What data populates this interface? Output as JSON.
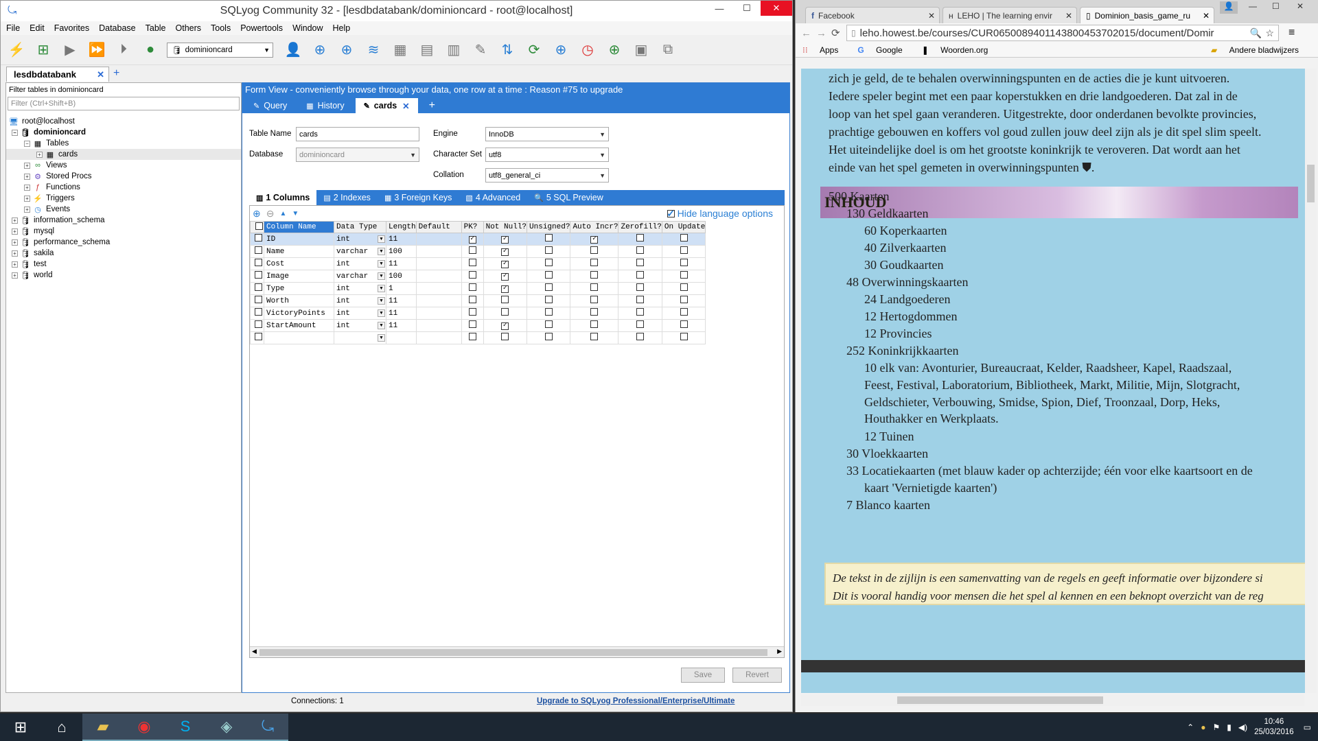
{
  "sqlyog": {
    "title": "SQLyog Community 32 - [lesdbdatabank/dominioncard - root@localhost]",
    "menu": [
      "File",
      "Edit",
      "Favorites",
      "Database",
      "Table",
      "Others",
      "Tools",
      "Powertools",
      "Window",
      "Help"
    ],
    "db_selector": "dominioncard",
    "connection_tab": "lesdbdatabank",
    "filter_label": "Filter tables in dominioncard",
    "filter_placeholder": "Filter (Ctrl+Shift+B)",
    "tree": {
      "root": "root@localhost",
      "db": "dominioncard",
      "tables": "Tables",
      "table": "cards",
      "views": "Views",
      "procs": "Stored Procs",
      "functions": "Functions",
      "triggers": "Triggers",
      "events": "Events",
      "other_dbs": [
        "information_schema",
        "mysql",
        "performance_schema",
        "sakila",
        "test",
        "world"
      ]
    },
    "banner": "Form View - conveniently browse through your data, one row at a time : Reason #75 to upgrade",
    "query_tabs": {
      "query": "Query",
      "history": "History",
      "cards": "cards"
    },
    "form": {
      "table_name_label": "Table Name",
      "table_name": "cards",
      "database_label": "Database",
      "database": "dominioncard",
      "engine_label": "Engine",
      "engine": "InnoDB",
      "charset_label": "Character Set",
      "charset": "utf8",
      "collation_label": "Collation",
      "collation": "utf8_general_ci"
    },
    "sub_tabs": {
      "columns": "1 Columns",
      "indexes": "2 Indexes",
      "fkeys": "3 Foreign Keys",
      "advanced": "4 Advanced",
      "preview": "5 SQL Preview"
    },
    "hide_language": "Hide language options",
    "headers": [
      "Column Name",
      "Data Type",
      "Length",
      "Default",
      "PK?",
      "Not Null?",
      "Unsigned?",
      "Auto Incr?",
      "Zerofill?",
      "On Update"
    ],
    "rows": [
      {
        "name": "ID",
        "type": "int",
        "length": "11",
        "default": "",
        "pk": true,
        "nn": true,
        "un": false,
        "ai": true,
        "zf": false,
        "ou": false
      },
      {
        "name": "Name",
        "type": "varchar",
        "length": "100",
        "default": "",
        "pk": false,
        "nn": true,
        "un": false,
        "ai": false,
        "zf": false,
        "ou": false
      },
      {
        "name": "Cost",
        "type": "int",
        "length": "11",
        "default": "",
        "pk": false,
        "nn": true,
        "un": false,
        "ai": false,
        "zf": false,
        "ou": false
      },
      {
        "name": "Image",
        "type": "varchar",
        "length": "100",
        "default": "",
        "pk": false,
        "nn": true,
        "un": false,
        "ai": false,
        "zf": false,
        "ou": false
      },
      {
        "name": "Type",
        "type": "int",
        "length": "1",
        "default": "",
        "pk": false,
        "nn": true,
        "un": false,
        "ai": false,
        "zf": false,
        "ou": false
      },
      {
        "name": "Worth",
        "type": "int",
        "length": "11",
        "default": "",
        "pk": false,
        "nn": false,
        "un": false,
        "ai": false,
        "zf": false,
        "ou": false
      },
      {
        "name": "VictoryPoints",
        "type": "int",
        "length": "11",
        "default": "",
        "pk": false,
        "nn": false,
        "un": false,
        "ai": false,
        "zf": false,
        "ou": false
      },
      {
        "name": "StartAmount",
        "type": "int",
        "length": "11",
        "default": "",
        "pk": false,
        "nn": true,
        "un": false,
        "ai": false,
        "zf": false,
        "ou": false
      },
      {
        "name": "",
        "type": "",
        "length": "",
        "default": "",
        "pk": false,
        "nn": false,
        "un": false,
        "ai": false,
        "zf": false,
        "ou": false
      }
    ],
    "save": "Save",
    "revert": "Revert",
    "connections": "Connections: 1",
    "upgrade": "Upgrade to SQLyog Professional/Enterprise/Ultimate"
  },
  "chrome": {
    "tabs": [
      "Facebook",
      "LEHO | The learning envir",
      "Dominion_basis_game_ru"
    ],
    "url": "leho.howest.be/courses/CUR0650089401143800453702015/document/Domir",
    "bookmarks": {
      "apps": "Apps",
      "google": "Google",
      "woorden": "Woorden.org",
      "other": "Andere bladwijzers"
    }
  },
  "pdf": {
    "intro": [
      "zich je geld, de te behalen overwinningspunten en de acties die je kunt uitvoeren.",
      "Iedere speler begint met een paar koperstukken en drie landgoederen. Dat zal in de",
      "loop van het spel gaan veranderen. Uitgestrekte, door onderdanen bevolkte provincies,",
      "prachtige gebouwen en koffers vol goud zullen jouw deel zijn als je dit spel slim speelt.",
      "Het uiteindelijke doel is om het grootste koninkrijk te veroveren. Dat wordt aan het",
      "einde van het spel gemeten in overwinningspunten"
    ],
    "heading": "INHOUD",
    "items": [
      {
        "t": "500 Kaarten",
        "l": 0
      },
      {
        "t": "130 Geldkaarten",
        "l": 1
      },
      {
        "t": "60 Koperkaarten",
        "l": 2
      },
      {
        "t": "40 Zilverkaarten",
        "l": 2
      },
      {
        "t": "30 Goudkaarten",
        "l": 2
      },
      {
        "t": "48 Overwinningskaarten",
        "l": 1
      },
      {
        "t": "24 Landgoederen",
        "l": 2
      },
      {
        "t": "12 Hertogdommen",
        "l": 2
      },
      {
        "t": "12 Provincies",
        "l": 2
      },
      {
        "t": "252 Koninkrijkkaarten",
        "l": 1
      },
      {
        "t": "10 elk van: Avonturier, Bureaucraat, Kelder, Raadsheer, Kapel, Raadszaal,",
        "l": 2
      },
      {
        "t": "Feest, Festival, Laboratorium, Bibliotheek, Markt, Militie, Mijn, Slotgracht,",
        "l": 2
      },
      {
        "t": "Geldschieter, Verbouwing, Smidse, Spion, Dief, Troonzaal, Dorp, Heks,",
        "l": 2
      },
      {
        "t": "Houthakker en Werkplaats.",
        "l": 2
      },
      {
        "t": "12 Tuinen",
        "l": 2
      },
      {
        "t": "30 Vloekkaarten",
        "l": 1
      },
      {
        "t": "33 Locatiekaarten (met blauw kader op achterzijde; één voor elke kaartsoort en de",
        "l": 1
      },
      {
        "t": "kaart 'Vernietigde kaarten')",
        "l": 1.5
      },
      {
        "t": "7 Blanco kaarten",
        "l": 1
      }
    ],
    "note": [
      "De tekst in de zijlijn is een samenvatting van de regels en geeft informatie over bijzondere si",
      "Dit is vooral handig voor mensen die het spel al kennen en een beknopt overzicht van de reg"
    ]
  },
  "taskbar": {
    "time": "10:46",
    "date": "25/03/2016"
  }
}
